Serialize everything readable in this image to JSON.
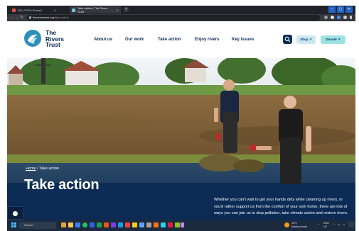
{
  "browser": {
    "tabs": [
      {
        "title": "RR_OPPN-Phase2"
      },
      {
        "title": "Take action | The Rivers Trust"
      }
    ],
    "url_domain": "theriverstrust.org",
    "url_path": "/take-action"
  },
  "site": {
    "logo": {
      "line1": "The",
      "line2": "Rivers",
      "line3": "Trust"
    },
    "nav": [
      "About us",
      "Our work",
      "Take action",
      "Enjoy rivers",
      "Key issues"
    ],
    "shop_label": "Shop",
    "donate_label": "Donate",
    "colors": {
      "brand_navy": "#0c2c57",
      "donate": "#9de3e5",
      "shop": "#c9e8f2"
    }
  },
  "hero": {
    "breadcrumb_home": "Home",
    "breadcrumb_sep": "/",
    "breadcrumb_current": "Take action",
    "title": "Take action",
    "text": "Whether you can't wait to get your hands dirty while cleaning up rivers, or you'd rather support us from the comfort of your own home, there are lots of ways you can join us to stop pollution, take climate action and restore rivers."
  },
  "taskbar": {
    "search": "Search",
    "weather_line1": "15°C",
    "weather_line2": "Mostly cloudy",
    "lang_line1": "ENG",
    "lang_line2": "UK"
  }
}
